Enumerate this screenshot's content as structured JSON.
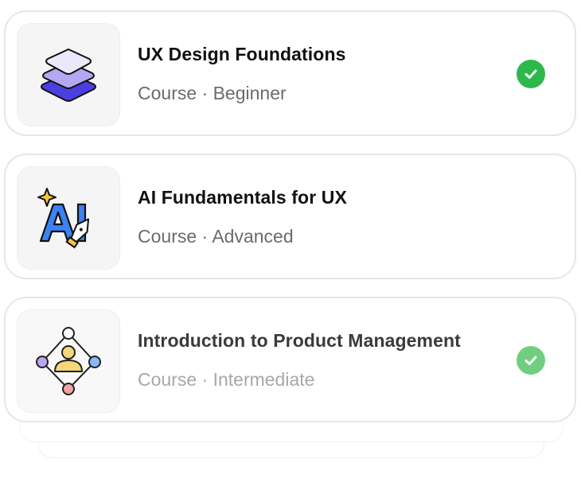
{
  "courses": [
    {
      "title": "UX Design Foundations",
      "meta": "Course · Beginner",
      "completed": true,
      "icon": "layers-icon",
      "check_color": "#2db84c"
    },
    {
      "title": "AI Fundamentals for UX",
      "meta": "Course · Advanced",
      "completed": false,
      "icon": "ai-pen-icon"
    },
    {
      "title": "Introduction to Product Management",
      "meta": "Course · Intermediate",
      "completed": true,
      "icon": "people-network-icon",
      "check_color": "#6fcf7f"
    }
  ],
  "colors": {
    "layer_top": "#ebe8fb",
    "layer_mid": "#b3a8f4",
    "layer_bottom": "#4b3fe0",
    "ai_blue": "#3b82f6",
    "ai_star": "#f5c542",
    "node_purple": "#b9a6f2",
    "node_blue": "#8ab9f5",
    "node_red": "#f0a4a4",
    "person_yellow": "#f4d77a"
  }
}
